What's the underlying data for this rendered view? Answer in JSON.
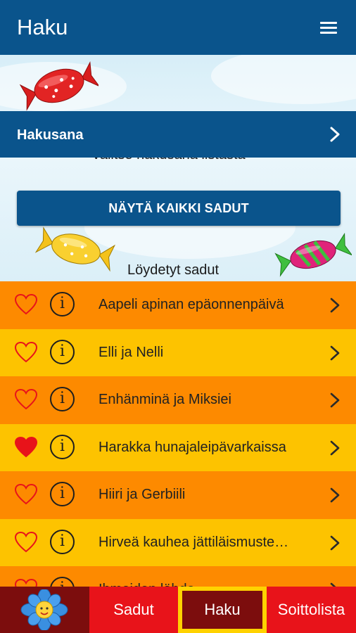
{
  "header": {
    "title": "Haku",
    "menu_icon": "hamburger-menu-icon"
  },
  "search": {
    "instruction": "Valitse hakusana listasta",
    "label": "Hakusana",
    "show_all_button": "NÄYTÄ KAIKKI SADUT",
    "results_title": "Löydetyt sadut"
  },
  "stories": [
    {
      "title": "Aapeli apinan epäonnenpäivä",
      "favorite": false,
      "color": "#fd8a00"
    },
    {
      "title": "Elli ja Nelli",
      "favorite": false,
      "color": "#fdc300"
    },
    {
      "title": "Enhänminä ja Miksiei",
      "favorite": false,
      "color": "#fd8a00"
    },
    {
      "title": "Harakka hunajaleipävarkaissa",
      "favorite": true,
      "color": "#fdc300"
    },
    {
      "title": "Hiiri ja Gerbiili",
      "favorite": false,
      "color": "#fd8a00"
    },
    {
      "title": "Hirveä kauhea jättiläismuste…",
      "favorite": false,
      "color": "#fdc300"
    },
    {
      "title": "Ihmeiden lähde",
      "favorite": false,
      "color": "#fd8a00"
    }
  ],
  "tabs": {
    "logo_icon": "flower-logo-icon",
    "sadut": "Sadut",
    "haku": "Haku",
    "soittolista": "Soittolista",
    "active": "Haku"
  },
  "colors": {
    "primary": "#0a548c",
    "row_orange": "#fd8a00",
    "row_yellow": "#fdc300",
    "favorite_heart": "#e8131a",
    "tabbar_red": "#e8131a",
    "tab_dark": "#7c0d0d",
    "tab_highlight": "#ffd200"
  }
}
